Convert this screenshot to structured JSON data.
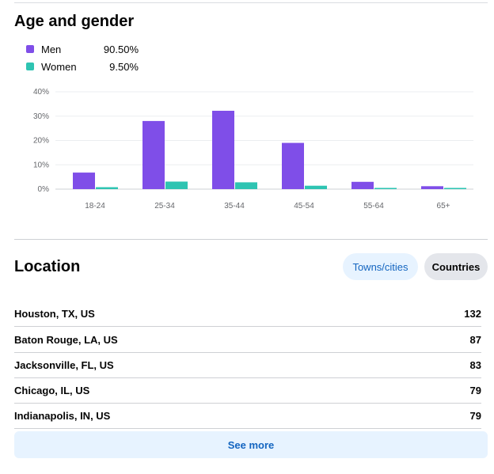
{
  "age_gender": {
    "title": "Age and gender",
    "legend": [
      {
        "label": "Men",
        "value": "90.50%",
        "color": "#7f4ee8"
      },
      {
        "label": "Women",
        "value": "9.50%",
        "color": "#2ec4b2"
      }
    ]
  },
  "chart_data": {
    "type": "bar",
    "categories": [
      "18-24",
      "25-34",
      "35-44",
      "45-54",
      "55-64",
      "65+"
    ],
    "series": [
      {
        "name": "Men",
        "values": [
          6.8,
          28.0,
          32.2,
          19.0,
          3.0,
          1.2
        ],
        "color": "#7f4ee8"
      },
      {
        "name": "Women",
        "values": [
          0.8,
          3.1,
          2.8,
          1.4,
          0.5,
          0.5
        ],
        "color": "#2ec4b2"
      }
    ],
    "yticks": [
      "0%",
      "10%",
      "20%",
      "30%",
      "40%"
    ],
    "ylim": [
      0,
      40
    ],
    "grid": true
  },
  "location": {
    "title": "Location",
    "tabs": [
      {
        "label": "Towns/cities",
        "active": true
      },
      {
        "label": "Countries",
        "active": false
      }
    ],
    "rows": [
      {
        "name": "Houston, TX, US",
        "count": "132"
      },
      {
        "name": "Baton Rouge, LA, US",
        "count": "87"
      },
      {
        "name": "Jacksonville, FL, US",
        "count": "83"
      },
      {
        "name": "Chicago, IL, US",
        "count": "79"
      },
      {
        "name": "Indianapolis, IN, US",
        "count": "79"
      }
    ],
    "see_more": "See more"
  }
}
